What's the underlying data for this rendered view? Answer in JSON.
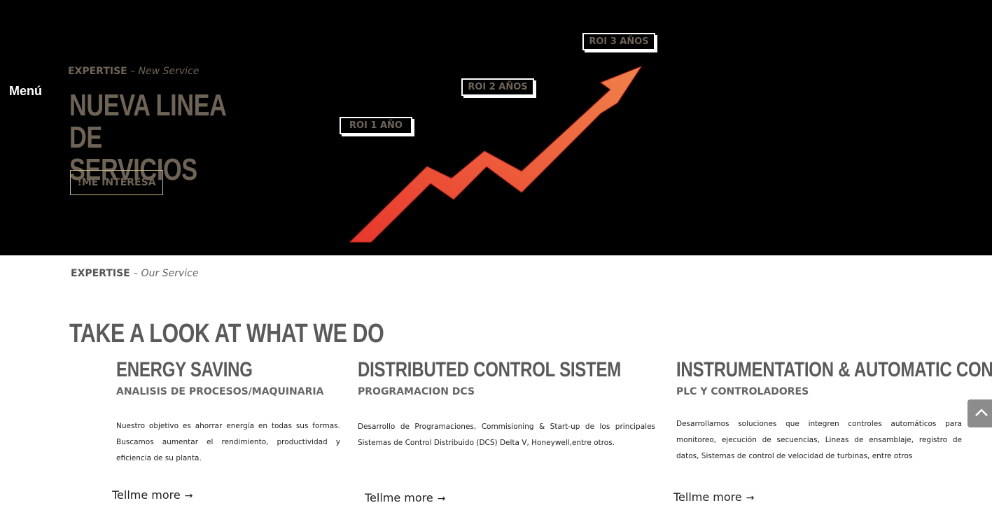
{
  "nav": {
    "menu_label": "Menú"
  },
  "hero": {
    "kicker_strong": "EXPERTISE",
    "kicker_sep": " – ",
    "kicker_em": "New Service",
    "title": "NUEVA LINEA DE SERVICIOS",
    "cta_label": "!ME INTERESA",
    "roi_labels": [
      "ROI 1 AÑO",
      "ROI 2 AÑOS",
      "ROI 3 AÑOS"
    ],
    "colors": {
      "background": "#000000",
      "accent_text": "#6e6456",
      "arrow_start": "#e8372c",
      "arrow_end": "#f0824a"
    }
  },
  "services": {
    "kicker_strong": "EXPERTISE",
    "kicker_sep": " – ",
    "kicker_em": "Our Service",
    "title": "TAKE A LOOK AT WHAT WE DO",
    "cards": [
      {
        "title": "ENERGY SAVING",
        "subtitle": "ANALISIS DE PROCESOS/MAQUINARIA",
        "text": "Nuestro objetivo es ahorrar energía en todas sus formas. Buscamos aumentar el rendimiento, productividad y eficiencia de su planta.",
        "link": "Tellme more",
        "link_icon": "arrow-right-icon"
      },
      {
        "title": "DISTRIBUTED CONTROL SISTEM",
        "subtitle": "PROGRAMACION DCS",
        "text": "Desarrollo de Programaciones, Commisioning & Start-up de los principales Sistemas de Control Distribuido (DCS) Delta V, Honeywell,entre otros.",
        "link": "Tellme more",
        "link_icon": "arrow-right-icon"
      },
      {
        "title": "INSTRUMENTATION & AUTOMATIC CONTROL",
        "subtitle": "PLC Y CONTROLADORES",
        "text": "Desarrollamos soluciones que integren controles automáticos para monitoreo, ejecución de secuencias, Lineas de ensamblaje, registro de datos, Sistemas de control de velocidad de turbinas, entre otros",
        "link": "Tellme more",
        "link_icon": "arrow-right-icon"
      }
    ]
  },
  "scroll_top": {
    "icon": "chevron-up-icon"
  }
}
